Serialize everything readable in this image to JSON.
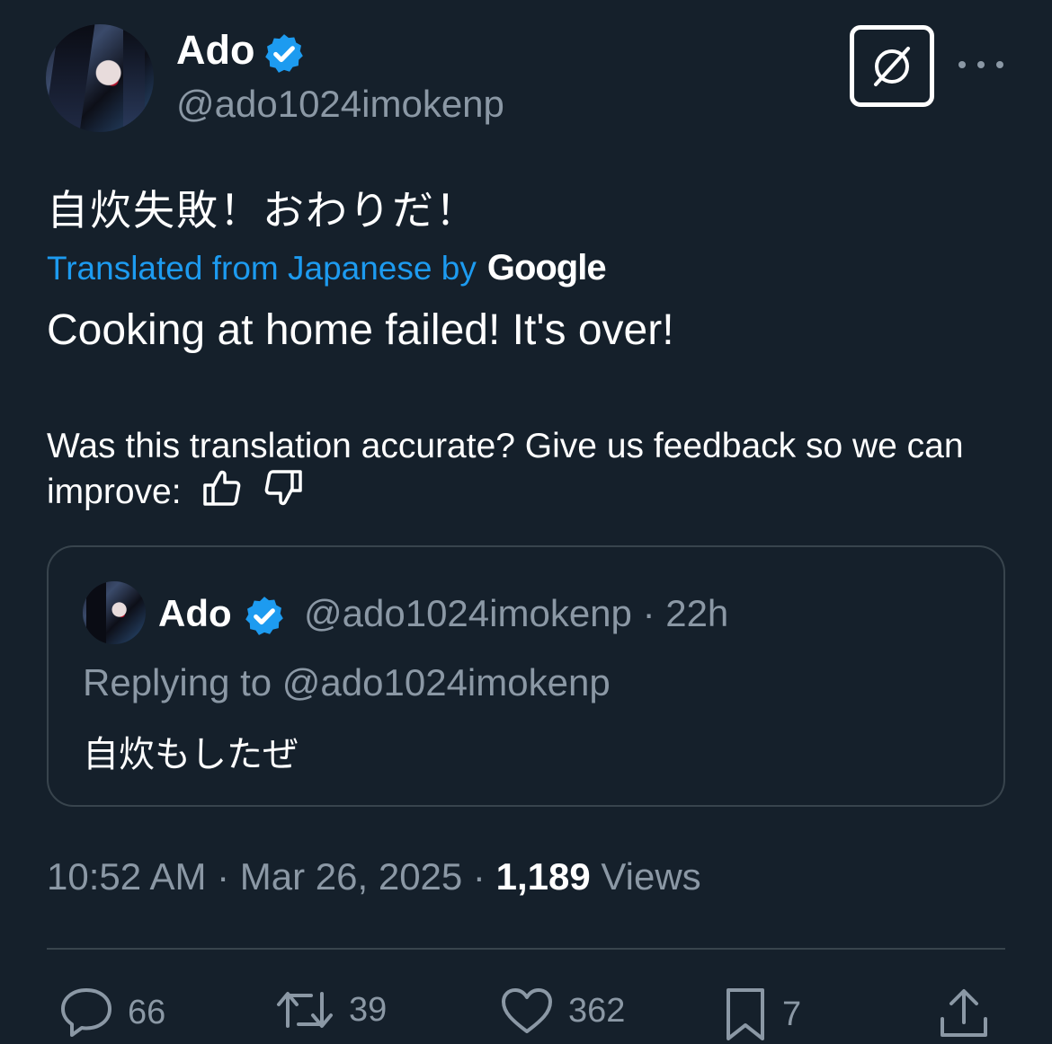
{
  "author": {
    "name": "Ado",
    "handle": "@ado1024imokenp"
  },
  "tweet": {
    "text": "自炊失敗！おわりだ！",
    "translated_from": "Translated from Japanese by",
    "translator": "Google",
    "translation": "Cooking at home failed! It's over!",
    "feedback_prompt": "Was this translation accurate? Give us feedback so we can improve:"
  },
  "quote": {
    "name": "Ado",
    "handle_time": "@ado1024imokenp · 22h",
    "replying_to": "Replying to @ado1024imokenp",
    "text": "自炊もしたぜ"
  },
  "meta": {
    "time_date": "10:52 AM · Mar 26, 2025 · ",
    "views_count": "1,189",
    "views_label": " Views"
  },
  "actions": {
    "replies": "66",
    "retweets": "39",
    "likes": "362",
    "bookmarks": "7"
  },
  "colors": {
    "background": "#15202b",
    "accent": "#1d9bf0",
    "secondary_text": "#8b98a5",
    "border": "#38444d"
  },
  "icons": [
    "verified-badge-icon",
    "grok-icon",
    "more-icon",
    "thumbs-up-icon",
    "thumbs-down-icon",
    "reply-icon",
    "retweet-icon",
    "like-icon",
    "bookmark-icon",
    "share-icon"
  ]
}
